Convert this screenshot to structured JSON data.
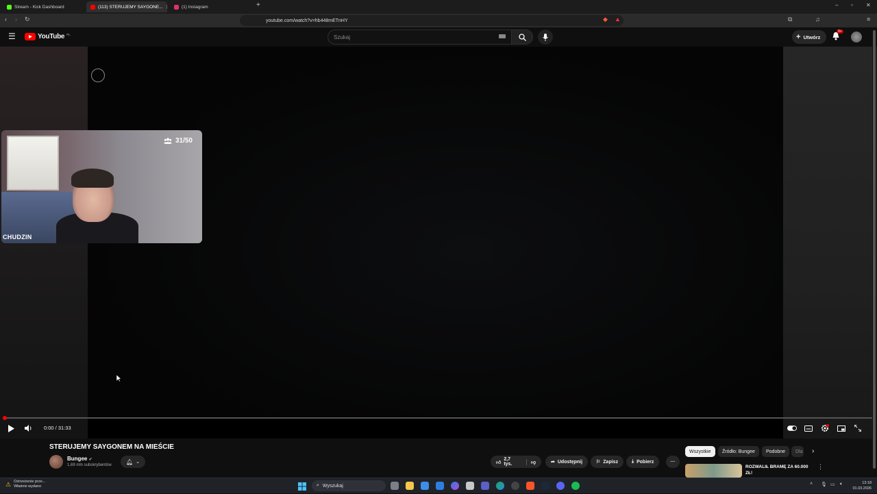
{
  "browser": {
    "tabs": [
      {
        "label": "Stream - Kick Dashboard",
        "favicon_color": "#53fc18"
      },
      {
        "label": "(113) STERUJEMY SAYGONE...",
        "favicon_color": "#ff0000"
      },
      {
        "label": "(1) Instagram",
        "favicon_color": "#e1306c"
      }
    ],
    "url": "youtube.com/watch?v=hb448mETnHY",
    "new_tab": "+",
    "window_controls": [
      "–",
      "▫",
      "✕"
    ]
  },
  "youtube": {
    "logo_text": "YouTube",
    "logo_region": "PL",
    "search_placeholder": "Szukaj",
    "create_label": "Utwórz",
    "notif_badge": "9+"
  },
  "webcam": {
    "viewer_count": "31/50",
    "streamer_name": "CHUDZIN"
  },
  "player": {
    "time": "0:00 / 31:33",
    "progress_fraction": 0.004
  },
  "video": {
    "title": "STERUJEMY SAYGONEM NA MIEŚCIE",
    "channel": "Bungee",
    "subscribers": "1,69 mln subskrybentów",
    "likes": "2,7 tys.",
    "share_label": "Udostępnij",
    "save_label": "Zapisz",
    "download_label": "Pobierz",
    "more_label": "···"
  },
  "recommendations": {
    "chips": [
      "Wszystkie",
      "Źródło: Bungee",
      "Podobne",
      "Dla"
    ],
    "first_title": "ROZWALIŁ BRAMĘ ZA 60.000 ZŁ!"
  },
  "taskbar": {
    "search_label": "Wyszukaj",
    "warning_title": "Ostrzeżenie prze...",
    "warning_sub": "Właśnie wydano",
    "time": "13:18",
    "date": "01.03.2026"
  },
  "colors": {
    "accent_red": "#ff0000",
    "background": "#0f0f0f",
    "chip_bg": "#272727"
  }
}
